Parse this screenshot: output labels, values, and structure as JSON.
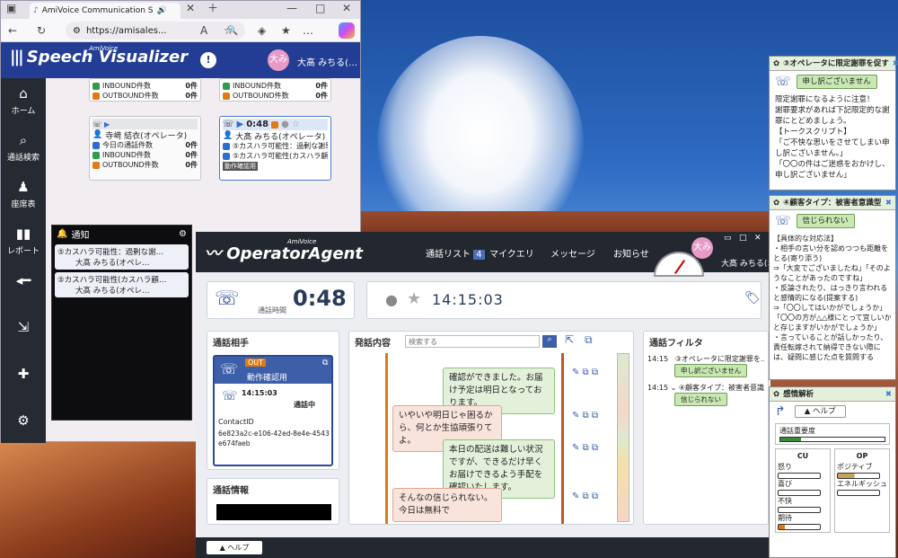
{
  "browser": {
    "tab_title": "AmiVoice Communication S",
    "url": "https://amisales...",
    "app_logo": "Speech Visualizer",
    "app_logo_small": "AmiVoice",
    "info_glyph": "!",
    "user_avatar": "大み",
    "user_name": "大髙 みちる(…"
  },
  "sidebar": {
    "items": [
      {
        "label": "ホーム",
        "icon": "home-icon"
      },
      {
        "label": "通話検索",
        "icon": "search-icon"
      },
      {
        "label": "座席表",
        "icon": "seat-icon"
      },
      {
        "label": "レポート",
        "icon": "report-icon"
      },
      {
        "label": "",
        "icon": "slider-icon"
      },
      {
        "label": "",
        "icon": "export-icon"
      },
      {
        "label": "",
        "icon": "add-icon"
      },
      {
        "label": "",
        "icon": "gear-icon"
      }
    ]
  },
  "seats": {
    "top_left": [
      {
        "label": "INBOUND件数",
        "value": "0件"
      },
      {
        "label": "OUTBOUND件数",
        "value": "0件"
      }
    ],
    "top_mid": [
      {
        "label": "INBOUND件数",
        "value": "0件"
      },
      {
        "label": "OUTBOUND件数",
        "value": "0件"
      }
    ],
    "agent1": {
      "name": "寺﨑 結衣(オペレータ)",
      "rows": [
        {
          "label": "今日の通話件数",
          "value": "0件"
        },
        {
          "label": "INBOUND件数",
          "value": "0件"
        },
        {
          "label": "OUTBOUND件数",
          "value": "0件"
        }
      ]
    },
    "agent2": {
      "timer": "0:48",
      "name": "大髙 みちる(オペレータ)",
      "rows": [
        {
          "label": "⑤カスハラ可能性：過剰な謝罪…"
        },
        {
          "label": "⑤カスハラ可能性(カスハラ顧客…"
        }
      ],
      "tag": "動作確認用"
    }
  },
  "notification": {
    "title": "通知",
    "items": [
      {
        "text": "⑤カスハラ可能性：過剰な謝…",
        "name": "大髙 みちる(オペレ…"
      },
      {
        "text": "⑤カスハラ可能性(カスハラ顧…",
        "name": "大髙 みちる(オペレ…"
      }
    ]
  },
  "oa": {
    "logo": "OperatorAgent",
    "logo_small": "AmiVoice",
    "nav": [
      {
        "label": "通話リスト",
        "badge": "4"
      },
      {
        "label": "マイクエリ"
      },
      {
        "label": "メッセージ"
      },
      {
        "label": "お知らせ"
      }
    ],
    "avatar": "大み",
    "user_name": "大髙 みちる(オペ…",
    "call_time_label": "通話時間",
    "call_time": "0:48",
    "clock": "14:15:03",
    "partner_title": "通話相手",
    "partner_tag": "OUT",
    "partner_note": "動作確認用",
    "partner_time": "14:15:03",
    "partner_status": "通話中",
    "contact_id_label": "ContactID",
    "contact_id": "6e823a2c-e106-42ed-8e4e-4543e674faeb",
    "info_title": "通話情報",
    "content_title": "発話内容",
    "search_placeholder": "検索する",
    "messages": [
      {
        "speaker": "op",
        "text": "確認ができました。お届け予定は明日となっております。"
      },
      {
        "speaker": "cu",
        "text": "いやいや明日じゃ困るから、何とか生協頑張りてよ。"
      },
      {
        "speaker": "op",
        "text": "本日の配送は難しい状況ですが、できるだけ早くお届けできるよう手配を確認いたします。"
      },
      {
        "speaker": "cu",
        "text": "そんなの信じられない。今日は無料で"
      }
    ],
    "filter_title": "通話フィルタ",
    "filters": [
      {
        "time": "14:15",
        "text": "③オペレータに限定謝罪を…",
        "button": "申し訳ございません"
      },
      {
        "time": "14:15",
        "text": "④顧客タイプ：被害者意識…",
        "button": "信じられない"
      }
    ],
    "help": "ヘルプ"
  },
  "popups": {
    "p1": {
      "title": "③オペレータに限定謝罪を促す",
      "button": "申し訳ございません",
      "lines": [
        "限定謝罪になるように注意！",
        "謝罪要求があれば下記限定的な謝罪にとどめましょう。",
        "【トークスクリプト】",
        "「ご不快な思いをさせてしまい申し訳ございません。」",
        "「〇〇の件はご迷惑をおかけし、申し訳ございません」"
      ]
    },
    "p2": {
      "title": "④顧客タイプ：被害者意識型",
      "button": "信じられない",
      "lines": [
        "【具体的な対応法】",
        "・相手の言い分を認めつつも距離をとる(寄り添う)",
        "⇒「大変でございましたね」「そのようなことがあったのですね」",
        "・反論されたり、はっきり言われると感情的になる(提案する)",
        "⇒「〇〇してはいかがでしょうか」「〇〇の方が△△様にとって宜しいかと存じますがいかがでしょうか」",
        "・言っていることが話しかったり、責任転嫁されて納得できない際には、疑問に感じた点を質問する"
      ]
    },
    "p3": {
      "title": "感情解析",
      "help": "ヘルプ",
      "importance_label": "通話重要度",
      "cu_title": "CU",
      "op_title": "OP",
      "cu": [
        "怒り",
        "喜び",
        "不快",
        "期待"
      ],
      "op": [
        "ポジティブ",
        "エネルギッシュ"
      ]
    }
  }
}
